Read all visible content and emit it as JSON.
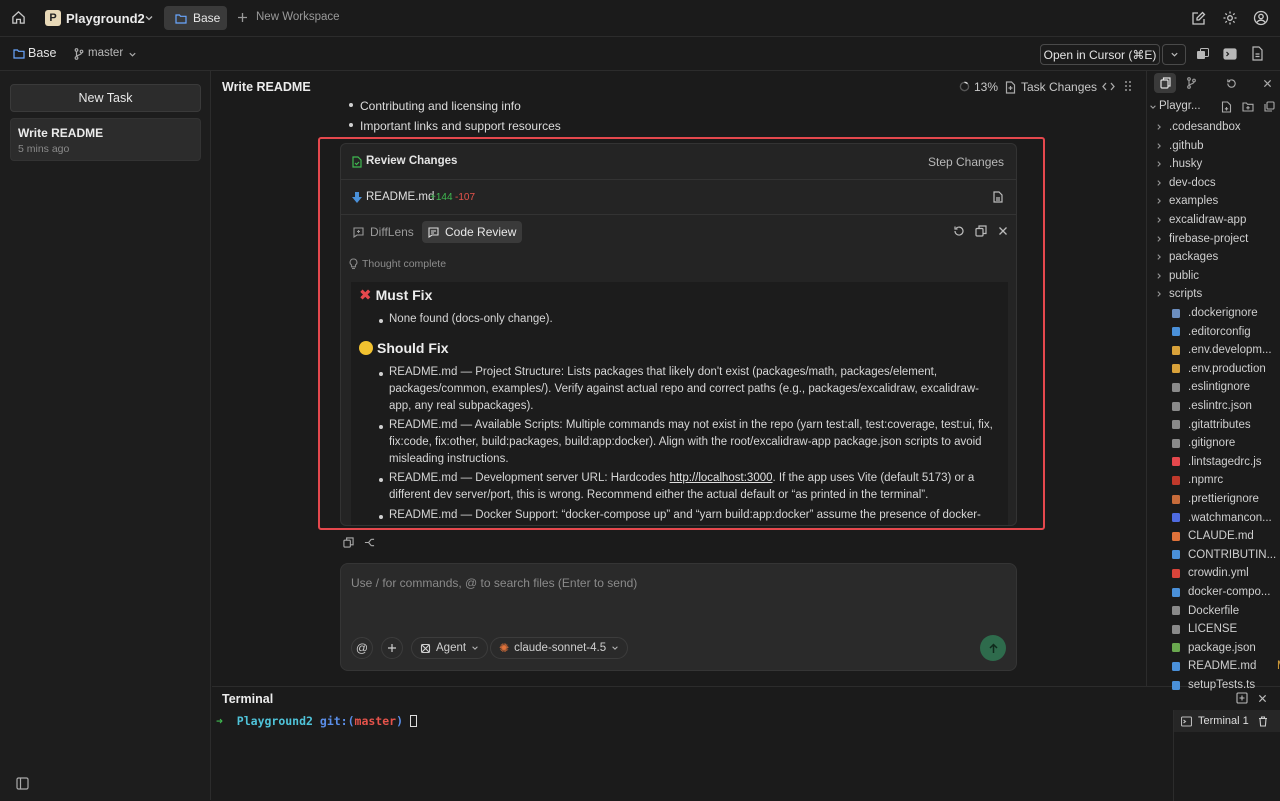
{
  "topbar": {
    "project_initial": "P",
    "project_name": "Playground2",
    "tab_base": "Base",
    "new_workspace": "New Workspace"
  },
  "subbar": {
    "workspace": "Base",
    "branch": "master",
    "open_in_cursor": "Open in Cursor (⌘E)"
  },
  "sidebar": {
    "new_task": "New Task",
    "task_title": "Write README",
    "task_time": "5 mins ago"
  },
  "main": {
    "title": "Write README",
    "progress": "13%",
    "task_changes": "Task Changes",
    "bullets": [
      "Contributing and licensing info",
      "Important links and support resources"
    ]
  },
  "review": {
    "header": "Review Changes",
    "step_changes": "Step Changes",
    "file_name": "README.md",
    "additions": "+144",
    "deletions": "-107",
    "tab_difflens": "DiffLens",
    "tab_code_review": "Code Review",
    "thought": "Thought complete",
    "must_fix_title": "Must Fix",
    "must_fix_items": [
      "None found (docs-only change)."
    ],
    "should_fix_title": "Should Fix",
    "should_fix_items": [
      "README.md — Project Structure: Lists packages that likely don't exist (packages/math, packages/element, packages/common, examples/). Verify against actual repo and correct paths (e.g., packages/excalidraw, excalidraw-app, any real subpackages).",
      "README.md — Available Scripts: Multiple commands may not exist in the repo (yarn test:all, test:coverage, test:ui, fix, fix:code, fix:other, build:packages, build:app:docker). Align with the root/excalidraw-app package.json scripts to avoid misleading instructions.",
      "README.md — Development server URL: Hardcodes ",
      "README.md — Docker Support: “docker-compose up” and “yarn build:app:docker” assume the presence of docker-"
    ],
    "dev_url": "http://localhost:3000",
    "dev_url_rest": ". If the app uses Vite (default 5173) or a different dev server/port, this is wrong. Recommend either the actual default or “as printed in the terminal”."
  },
  "composer": {
    "placeholder": "Use / for commands, @ to search files (Enter to send)",
    "mode": "Agent",
    "model": "claude-sonnet-4.5"
  },
  "explorer": {
    "root": "Playgr...",
    "items": [
      {
        "name": ".codesandbox",
        "type": "folder"
      },
      {
        "name": ".github",
        "type": "folder"
      },
      {
        "name": ".husky",
        "type": "folder"
      },
      {
        "name": "dev-docs",
        "type": "folder"
      },
      {
        "name": "examples",
        "type": "folder"
      },
      {
        "name": "excalidraw-app",
        "type": "folder"
      },
      {
        "name": "firebase-project",
        "type": "folder"
      },
      {
        "name": "packages",
        "type": "folder"
      },
      {
        "name": "public",
        "type": "folder"
      },
      {
        "name": "scripts",
        "type": "folder"
      },
      {
        "name": ".dockerignore",
        "type": "file",
        "color": "#6c8ebf"
      },
      {
        "name": ".editorconfig",
        "type": "file",
        "color": "#4a90d9"
      },
      {
        "name": ".env.developm...",
        "type": "file",
        "color": "#d9a23a"
      },
      {
        "name": ".env.production",
        "type": "file",
        "color": "#d9a23a"
      },
      {
        "name": ".eslintignore",
        "type": "file",
        "color": "#8a8a8a"
      },
      {
        "name": ".eslintrc.json",
        "type": "file",
        "color": "#8a8a8a"
      },
      {
        "name": ".gitattributes",
        "type": "file",
        "color": "#8a8a8a"
      },
      {
        "name": ".gitignore",
        "type": "file",
        "color": "#8a8a8a"
      },
      {
        "name": ".lintstagedrc.js",
        "type": "file",
        "color": "#e5484d"
      },
      {
        "name": ".npmrc",
        "type": "file",
        "color": "#c0392b"
      },
      {
        "name": ".prettierignore",
        "type": "file",
        "color": "#c76b3a"
      },
      {
        "name": ".watchmancon...",
        "type": "file",
        "color": "#4f6be0"
      },
      {
        "name": "CLAUDE.md",
        "type": "file",
        "color": "#e0723a"
      },
      {
        "name": "CONTRIBUTIN...",
        "type": "file",
        "color": "#4a90d9"
      },
      {
        "name": "crowdin.yml",
        "type": "file",
        "color": "#d9443a"
      },
      {
        "name": "docker-compo...",
        "type": "file",
        "color": "#4a90d9"
      },
      {
        "name": "Dockerfile",
        "type": "file",
        "color": "#8a8a8a"
      },
      {
        "name": "LICENSE",
        "type": "file",
        "color": "#8a8a8a"
      },
      {
        "name": "package.json",
        "type": "file",
        "color": "#6aa84f"
      },
      {
        "name": "README.md",
        "type": "file",
        "color": "#4a90d9",
        "badge": "M"
      },
      {
        "name": "setupTests.ts",
        "type": "file",
        "color": "#4a90d9"
      }
    ]
  },
  "terminal": {
    "title": "Terminal",
    "tab": "Terminal 1",
    "prompt_arrow": "➜",
    "prompt_dir": "Playground2",
    "prompt_git": "git:(",
    "prompt_branch": "master",
    "prompt_git_close": ")"
  }
}
